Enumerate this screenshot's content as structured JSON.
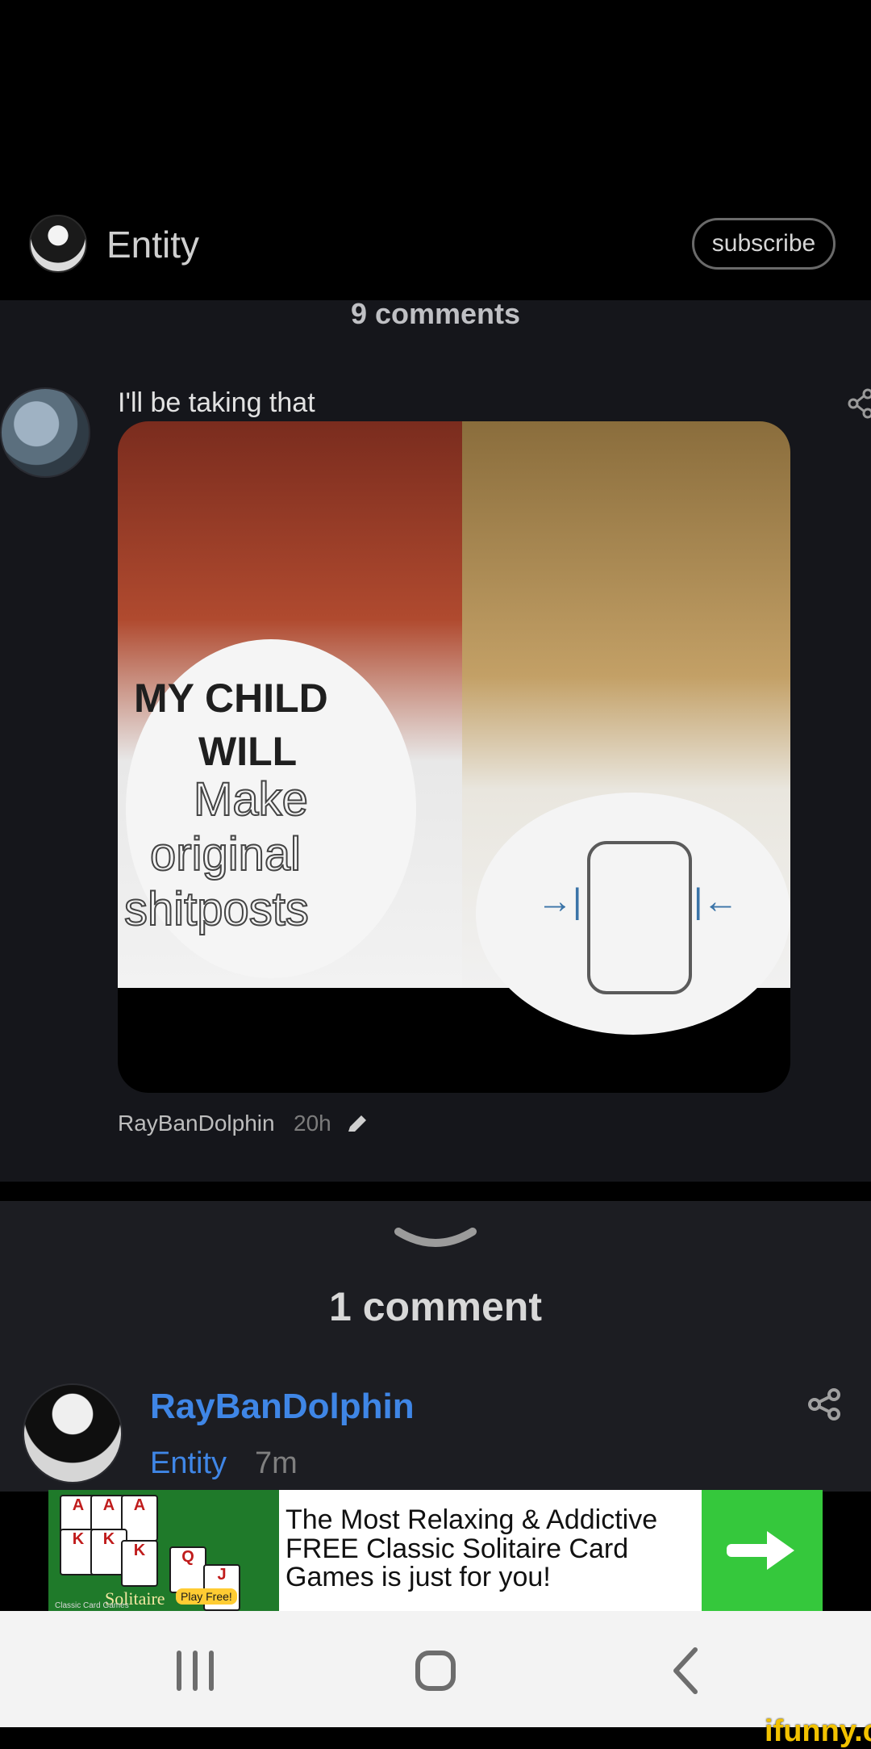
{
  "header": {
    "title": "Entity",
    "subscribe_label": "subscribe"
  },
  "comments_panel": {
    "count_label": "9 comments",
    "comment": {
      "text": "I'll be taking that",
      "author": "RayBanDolphin",
      "time": "20h"
    },
    "meme": {
      "left_text_line1": "MY CHILD",
      "left_text_line2": "WILL",
      "left_text_line3": "Make",
      "left_text_line4": "original",
      "left_text_line5": "shitposts",
      "arrow_left": "→|",
      "arrow_right": "|←"
    }
  },
  "sheet": {
    "count_label": "1 comment",
    "reply": {
      "name": "RayBanDolphin",
      "subtitle_label": "Entity",
      "time": "7m"
    }
  },
  "ad": {
    "text": "The Most Relaxing & Addictive FREE Classic Solitaire Card Games is just for you!",
    "logo_text": "Solitaire",
    "logo_sub": "Classic Card Games",
    "badge": "Play Free!"
  },
  "watermark": "ifunny.co",
  "icons": {
    "header_avatar": "user-avatar-icon",
    "comment_share": "share-icon",
    "edit": "pencil-icon",
    "chevron": "chevron-down-icon",
    "reply_share": "share-icon",
    "cta": "arrow-right-icon",
    "nav_recent": "recent-apps-icon",
    "nav_home": "home-icon",
    "nav_back": "back-icon"
  },
  "colors": {
    "accent_blue": "#3f86e6",
    "ad_green": "#35c83c",
    "watermark": "#f2c200"
  }
}
